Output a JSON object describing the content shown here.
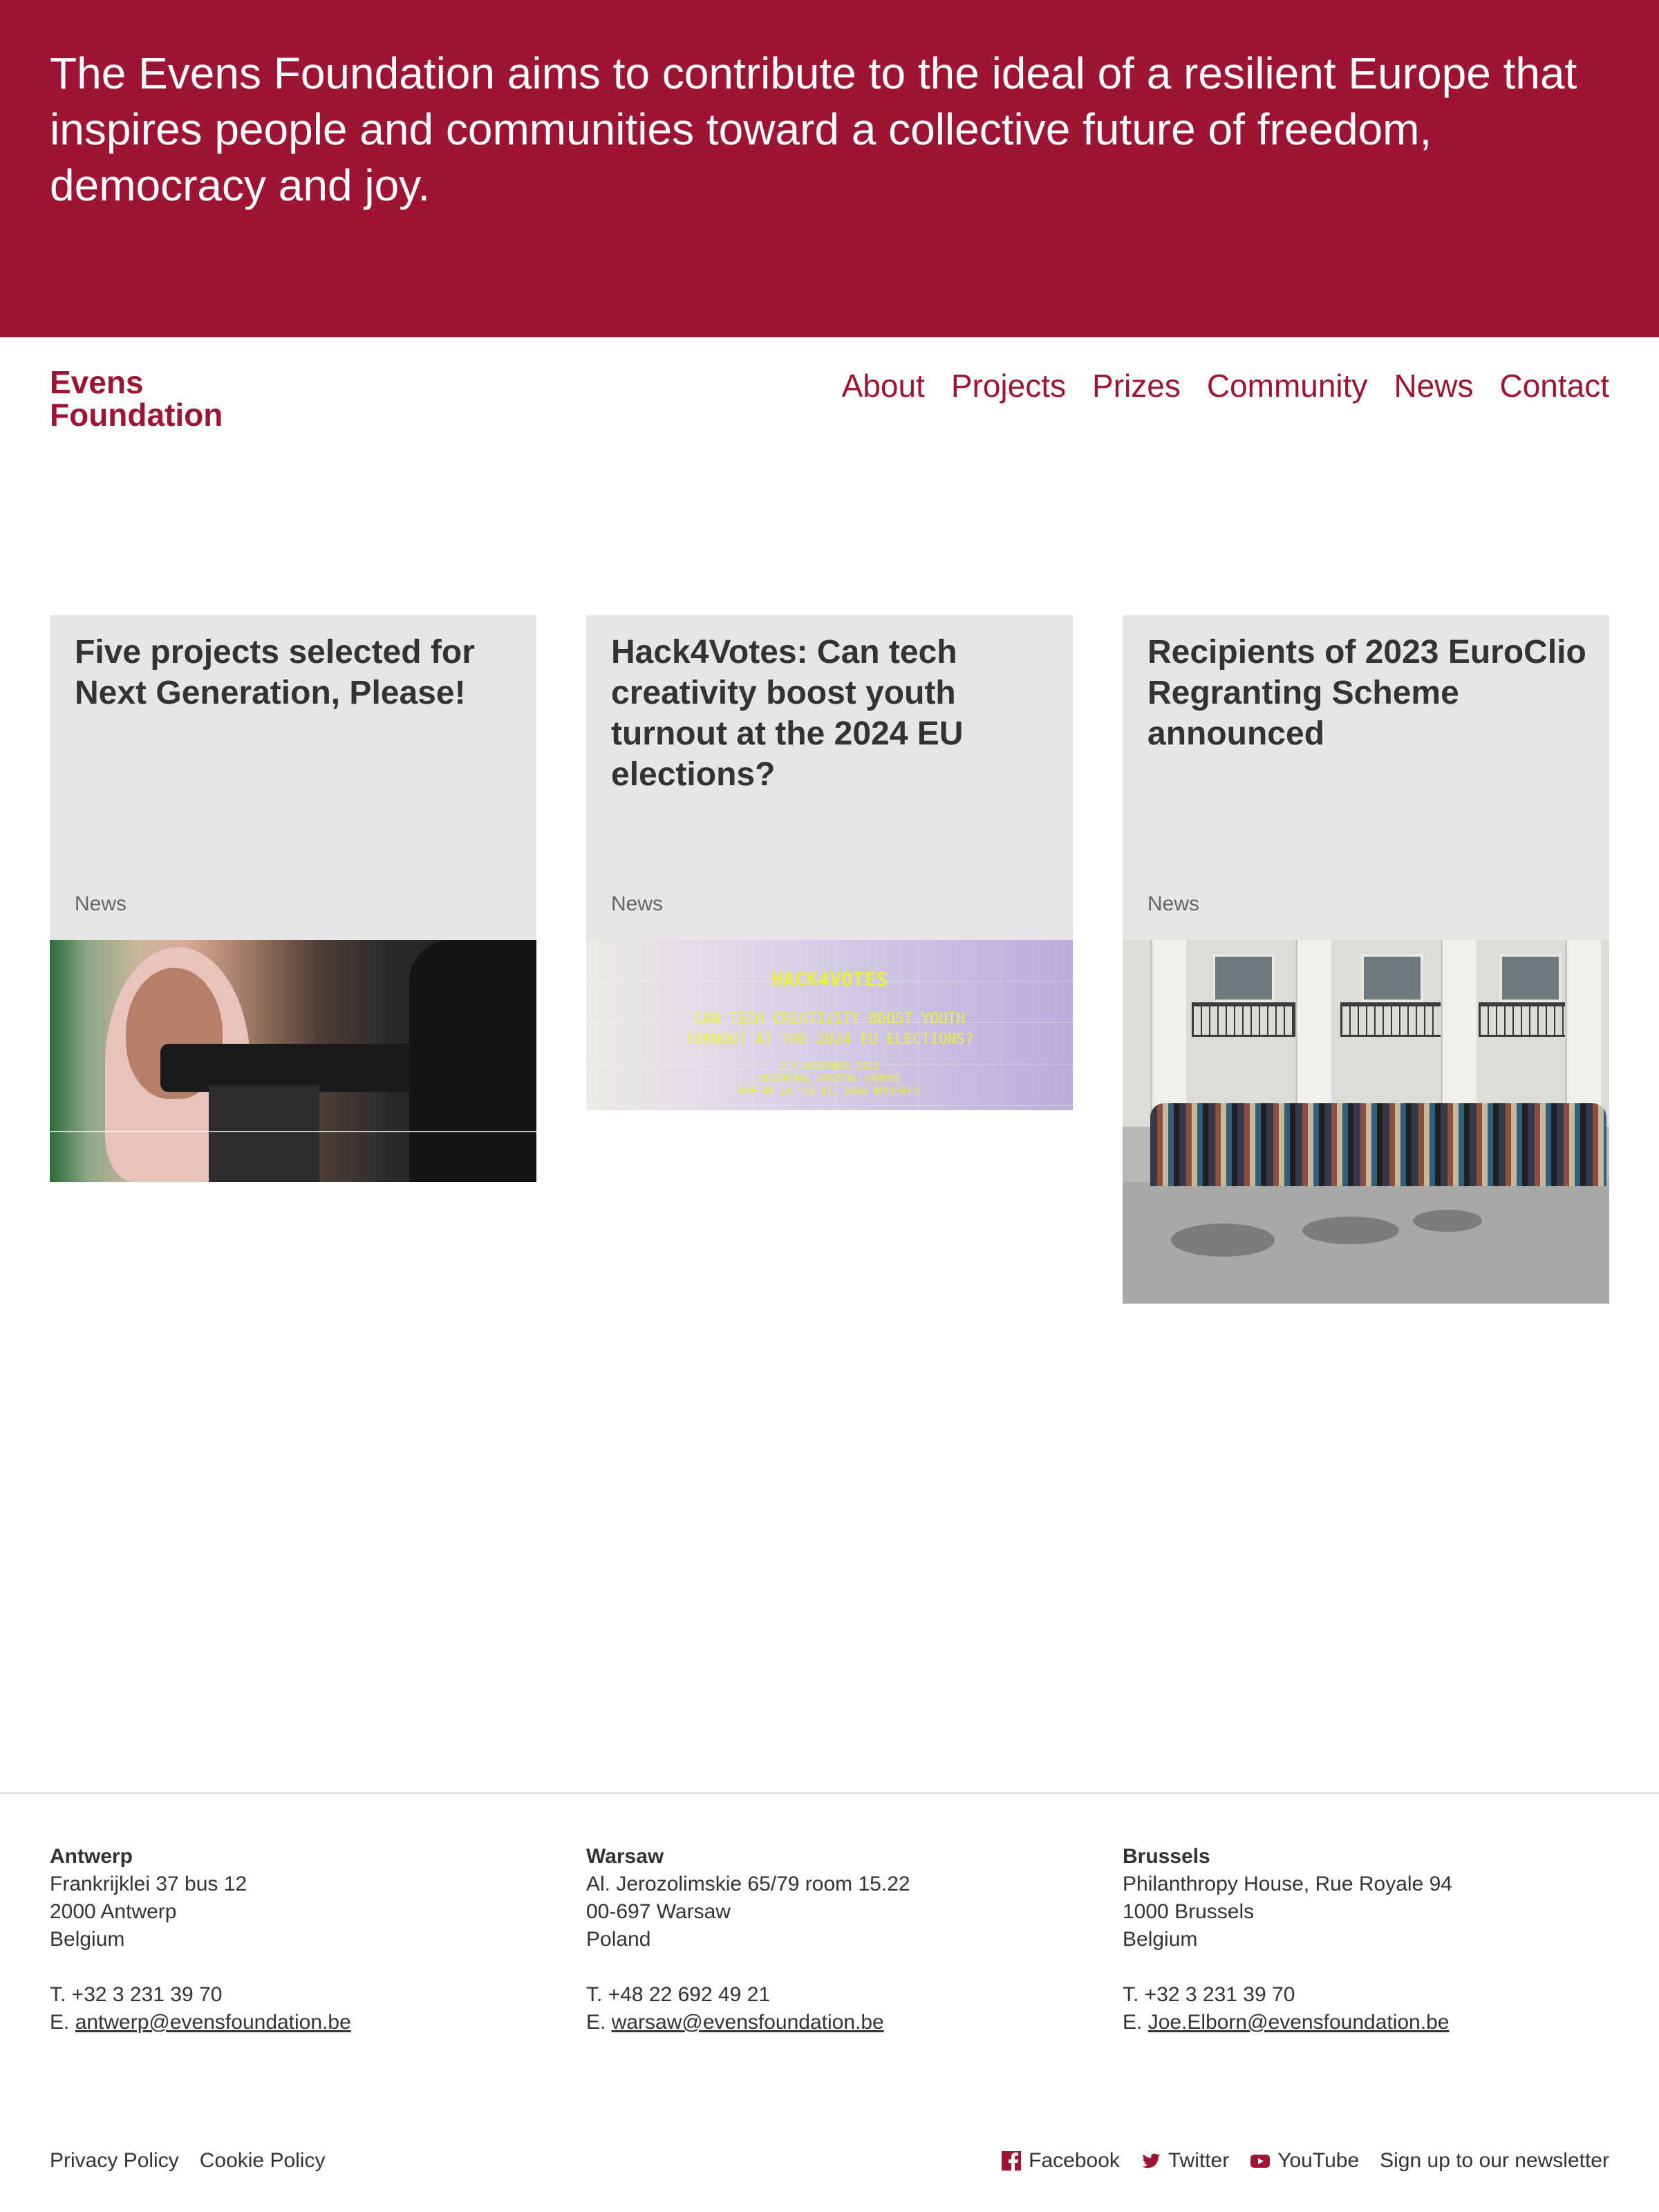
{
  "hero": {
    "statement": "The Evens Foundation aims to contribute to the ideal of a resilient Europe that inspires people and communities toward a collective future of freedom, democracy and joy."
  },
  "brand": {
    "line1": "Evens",
    "line2": "Foundation",
    "color": "#9e1433"
  },
  "nav": {
    "items": [
      "About",
      "Projects",
      "Prizes",
      "Community",
      "News",
      "Contact"
    ]
  },
  "cards": [
    {
      "title": "Five projects selected for Next Generation, Please!",
      "tag": "News",
      "image": "videographer-photo"
    },
    {
      "title": "Hack4Votes: Can tech creativity boost youth turnout at the 2024 EU elections?",
      "tag": "News",
      "image": "hack4votes-poster",
      "image_text": {
        "headline": "HACK4VOTES",
        "subline1": "CAN TECH CREATIVITY BOOST YOUTH",
        "subline2": "TURNOUT AT THE 2024 EU ELECTIONS?",
        "detail1": "2-3 DECEMBER 2023",
        "detail2": "DECENTRAL DIGITAL CAMPUS",
        "detail3": "RUE DE LA LOI 42, 1040 BRUSSELS"
      }
    },
    {
      "title": "Recipients of 2023 EuroClio Regranting Scheme announced",
      "tag": "News",
      "image": "group-photo"
    }
  ],
  "footer": {
    "offices": [
      {
        "city": "Antwerp",
        "address1": "Frankrijklei 37 bus 12",
        "address2": "2000 Antwerp",
        "country": "Belgium",
        "phone": "T. +32 3 231 39 70",
        "email_prefix": "E. ",
        "email": "antwerp@evensfoundation.be"
      },
      {
        "city": "Warsaw",
        "address1": "Al. Jerozolimskie 65/79 room 15.22",
        "address2": "00-697 Warsaw",
        "country": "Poland",
        "phone": "T. +48 22 692 49 21",
        "email_prefix": "E. ",
        "email": "warsaw@evensfoundation.be"
      },
      {
        "city": "Brussels",
        "address1": "Philanthropy House, Rue Royale 94",
        "address2": "1000 Brussels",
        "country": "Belgium",
        "phone": "T. +32 3 231 39 70",
        "email_prefix": "E. ",
        "email": "Joe.Elborn@evensfoundation.be"
      }
    ],
    "legal": [
      "Privacy Policy",
      "Cookie Policy"
    ],
    "social": [
      {
        "label": "Facebook",
        "icon": "facebook-icon"
      },
      {
        "label": "Twitter",
        "icon": "twitter-icon"
      },
      {
        "label": "YouTube",
        "icon": "youtube-icon"
      }
    ],
    "newsletter": "Sign up to our newsletter"
  }
}
